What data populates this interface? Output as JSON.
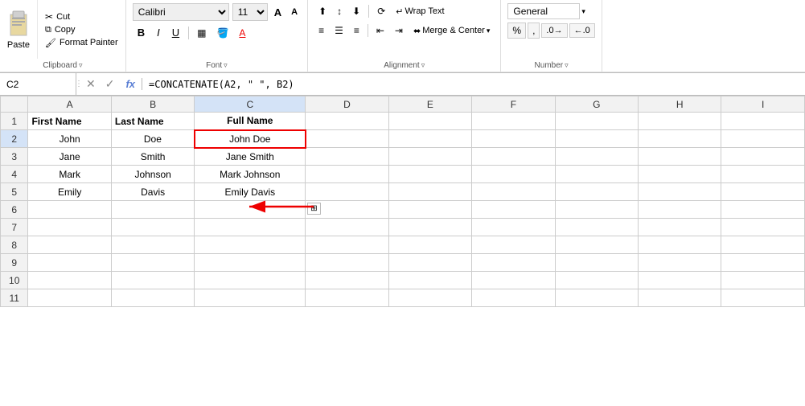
{
  "ribbon": {
    "clipboard": {
      "label": "Clipboard",
      "paste_label": "Paste",
      "cut_label": "Cut",
      "copy_label": "Copy",
      "format_painter_label": "Format Painter"
    },
    "font": {
      "label": "Font",
      "font_name": "Calibri",
      "font_size": "11",
      "bold": "B",
      "italic": "I",
      "underline": "U",
      "increase_font": "A",
      "decrease_font": "A"
    },
    "alignment": {
      "label": "Alignment",
      "wrap_text": "Wrap Text",
      "merge_center": "Merge & Center"
    },
    "number": {
      "label": "Number",
      "format": "General"
    }
  },
  "formula_bar": {
    "cell_ref": "C2",
    "formula": "=CONCATENATE(A2, \" \", B2)"
  },
  "sheet": {
    "col_headers": [
      "",
      "A",
      "B",
      "C",
      "D",
      "E",
      "F",
      "G",
      "H",
      "I"
    ],
    "rows": [
      {
        "row": "1",
        "a": "First Name",
        "b": "Last Name",
        "c": "Full Name",
        "d": "",
        "e": "",
        "f": "",
        "g": "",
        "h": "",
        "i": ""
      },
      {
        "row": "2",
        "a": "John",
        "b": "Doe",
        "c": "John Doe",
        "d": "",
        "e": "",
        "f": "",
        "g": "",
        "h": "",
        "i": ""
      },
      {
        "row": "3",
        "a": "Jane",
        "b": "Smith",
        "c": "Jane Smith",
        "d": "",
        "e": "",
        "f": "",
        "g": "",
        "h": "",
        "i": ""
      },
      {
        "row": "4",
        "a": "Mark",
        "b": "Johnson",
        "c": "Mark Johnson",
        "d": "",
        "e": "",
        "f": "",
        "g": "",
        "h": "",
        "i": ""
      },
      {
        "row": "5",
        "a": "Emily",
        "b": "Davis",
        "c": "Emily Davis",
        "d": "",
        "e": "",
        "f": "",
        "g": "",
        "h": "",
        "i": ""
      },
      {
        "row": "6",
        "a": "",
        "b": "",
        "c": "",
        "d": "",
        "e": "",
        "f": "",
        "g": "",
        "h": "",
        "i": ""
      },
      {
        "row": "7",
        "a": "",
        "b": "",
        "c": "",
        "d": "",
        "e": "",
        "f": "",
        "g": "",
        "h": "",
        "i": ""
      },
      {
        "row": "8",
        "a": "",
        "b": "",
        "c": "",
        "d": "",
        "e": "",
        "f": "",
        "g": "",
        "h": "",
        "i": ""
      },
      {
        "row": "9",
        "a": "",
        "b": "",
        "c": "",
        "d": "",
        "e": "",
        "f": "",
        "g": "",
        "h": "",
        "i": ""
      },
      {
        "row": "10",
        "a": "",
        "b": "",
        "c": "",
        "d": "",
        "e": "",
        "f": "",
        "g": "",
        "h": "",
        "i": ""
      },
      {
        "row": "11",
        "a": "",
        "b": "",
        "c": "",
        "d": "",
        "e": "",
        "f": "",
        "g": "",
        "h": "",
        "i": ""
      }
    ]
  }
}
